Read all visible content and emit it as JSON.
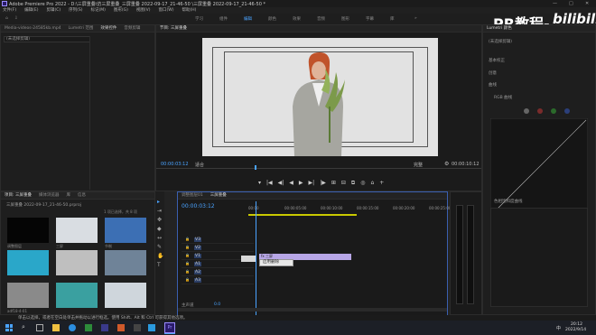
{
  "window": {
    "title": "Adobe Premiere Pro 2022 - D:\\三屏重叠\\仿三屏重叠_三屏重叠 2022-09-17_21-46-50 \\三屏重叠 2022-09-17_21-46-50 *",
    "minimize": "—",
    "maximize": "□",
    "close": "✕"
  },
  "menu": [
    "文件(F)",
    "编辑(E)",
    "剪辑(C)",
    "序列(S)",
    "标记(M)",
    "图形(G)",
    "视图(V)",
    "窗口(W)",
    "帮助(H)"
  ],
  "workspaces": [
    "学习",
    "组件",
    "编辑",
    "颜色",
    "效果",
    "音频",
    "图形",
    "字幕",
    "库",
    "»"
  ],
  "workspace_active": "编辑",
  "source_panel": {
    "tabs": [
      "Media-videos-24585kb.mp4",
      "Lumetri 范围",
      "效果控件",
      "音频剪辑"
    ],
    "active_tab": "效果控件",
    "no_selection": "(未选择剪辑)"
  },
  "program_monitor": {
    "tab": "节目: 三屏重叠",
    "timecode_left": "00:00:03:12",
    "fit": "适合",
    "quality": "完整",
    "timecode_right": "00:00:10:12",
    "controls": [
      "▾",
      "|◀",
      "◀|",
      "◀",
      "▶",
      "▶|",
      "|▶",
      "⊞",
      "⊟",
      "⧉",
      "◎",
      "⌂",
      "+"
    ]
  },
  "watermark": {
    "pr": "PR教程-",
    "bili": "bilibili"
  },
  "project_panel": {
    "tabs": [
      "项目: 三屏重叠",
      "媒体浏览器",
      "库",
      "信息"
    ],
    "path": "三屏重叠 2022-09-17_21-46-50.prproj",
    "count": "1 项已选择，共 8 项",
    "items": [
      {
        "name": "调整图层",
        "dur": "",
        "color": "#050505"
      },
      {
        "name": "三屏",
        "dur": "",
        "color": "#d9dde2"
      },
      {
        "name": "节制",
        "dur": "",
        "color": "#3c6fb4"
      },
      {
        "name": "",
        "dur": "",
        "color": "#2aa7c9"
      },
      {
        "name": "",
        "dur": "",
        "color": "#bfbfbf"
      },
      {
        "name": "",
        "dur": "",
        "color": "#6f8398"
      },
      {
        "name": "adf18-4-01",
        "dur": "",
        "color": "#8a8a8a"
      },
      {
        "name": "",
        "dur": "",
        "color": "#3aa0a0"
      },
      {
        "name": "",
        "dur": "",
        "color": "#cfd6dc"
      }
    ]
  },
  "timeline": {
    "tabs": [
      "调整图层01",
      "三屏重叠"
    ],
    "active_tab": "三屏重叠",
    "timecode": "00:00:03:12",
    "ruler": [
      "00:00",
      "00:00:05:00",
      "00:00:10:00",
      "00:00:15:00",
      "00:00:20:00",
      "00:00:25:00"
    ],
    "video_tracks": [
      "V3",
      "V2",
      "V1"
    ],
    "audio_tracks": [
      "A1",
      "A2",
      "A3"
    ],
    "master": "主声道",
    "master_value": "0.0",
    "clip_label": "fx 三屏",
    "context_menu": "启用删除"
  },
  "lumetri": {
    "tabs": [
      "Lumetri 颜色"
    ],
    "title": "(未选择剪辑)",
    "sections": [
      "基本校正",
      "创意",
      "曲线",
      "RGB 曲线",
      "色相饱和度曲线",
      "色轮和匹配",
      "HSL 辅助",
      "晕影"
    ]
  },
  "status": {
    "text": "单击以选择，或者在空白处单击并拖动以进行框选。使用 Shift、Alt 和 Ctrl 可获得其他选项。"
  },
  "taskbar": {
    "time": "20:12",
    "date": "2022/9/14",
    "lang": "中"
  }
}
